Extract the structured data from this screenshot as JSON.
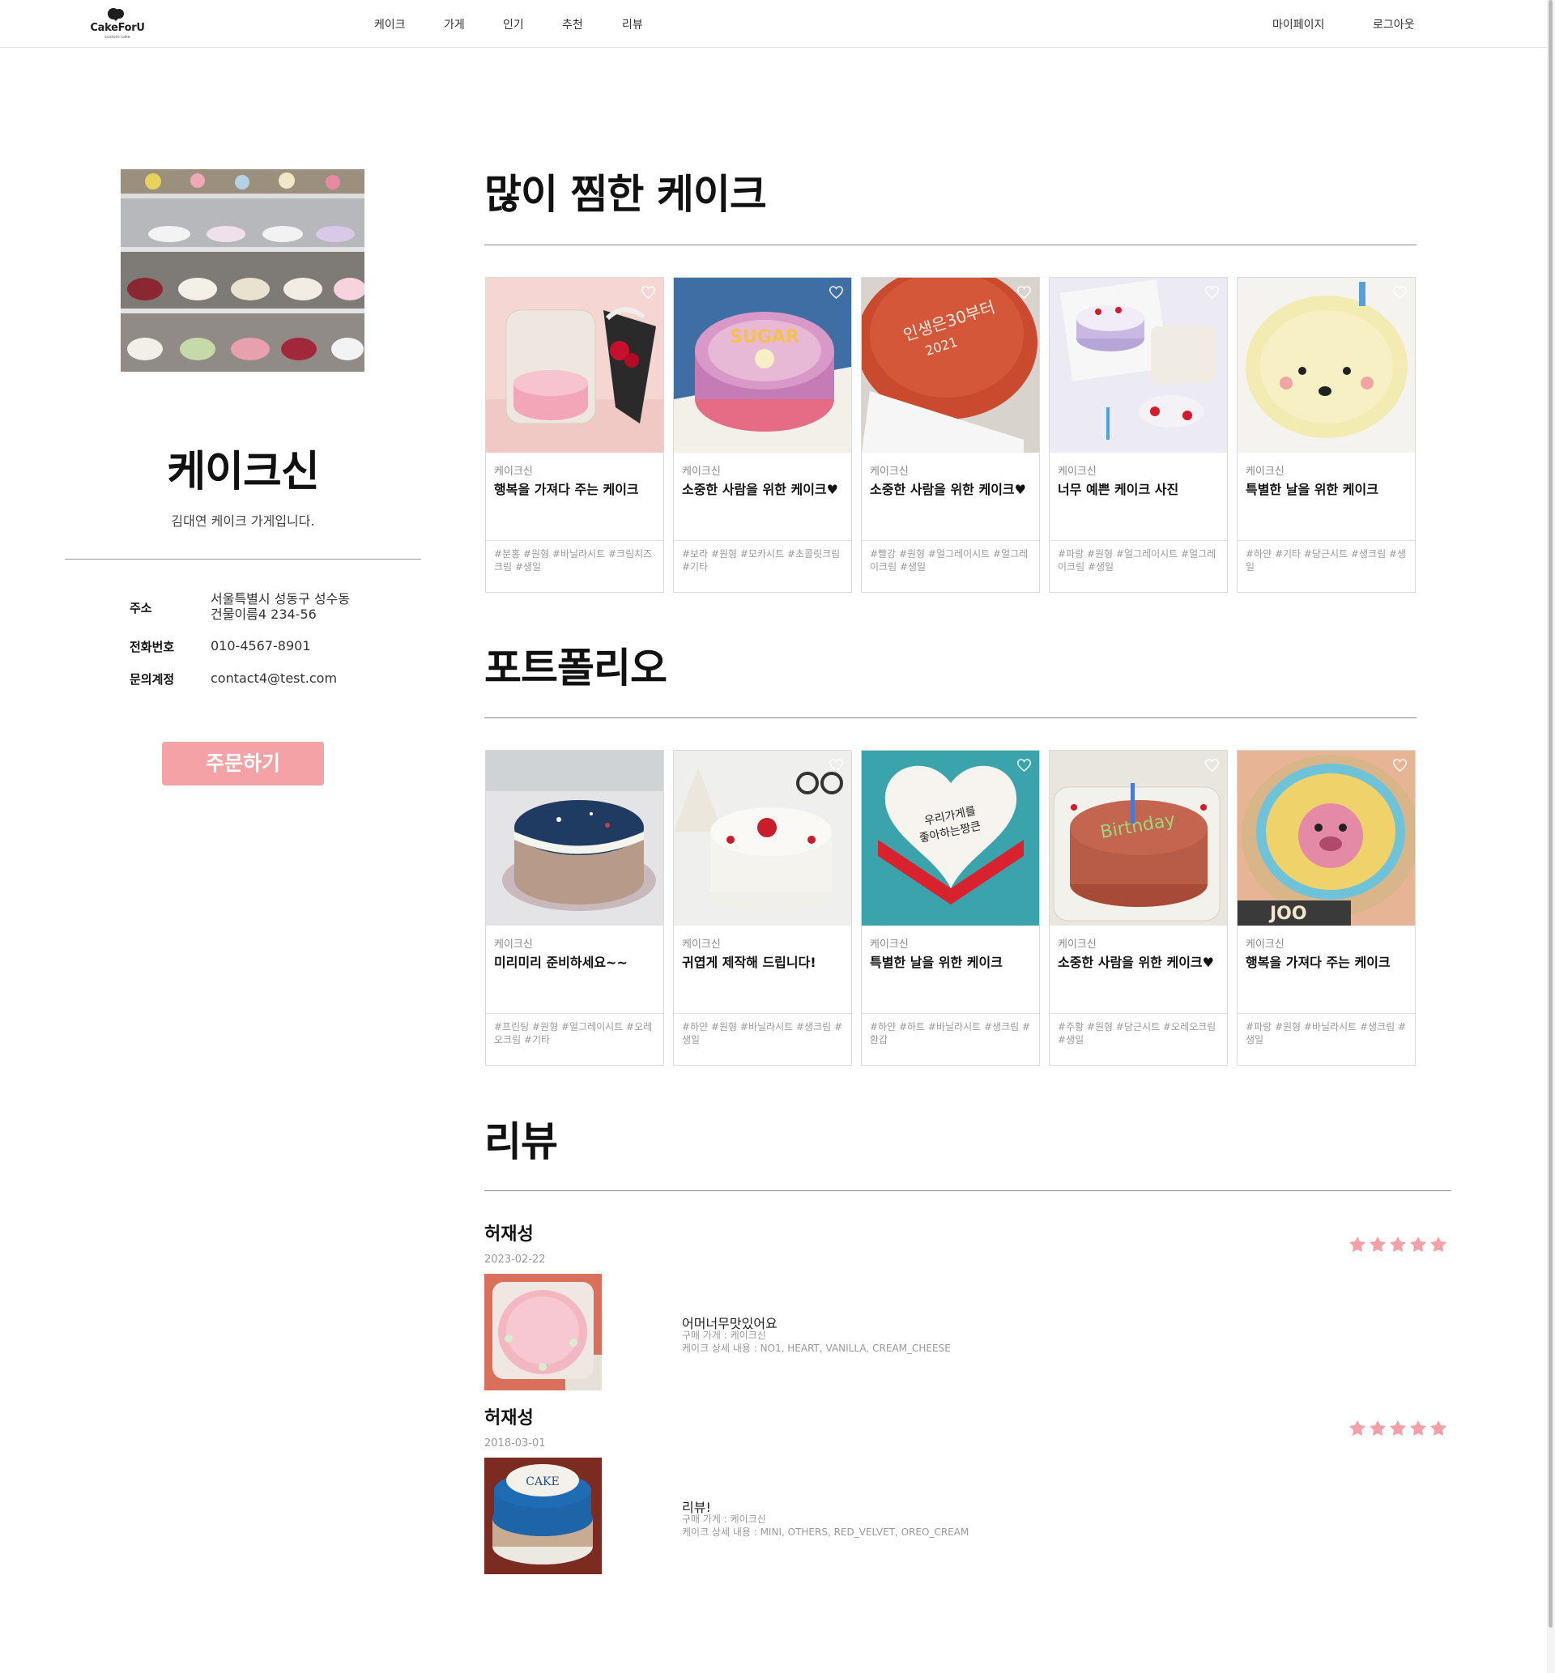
{
  "header": {
    "logo_text": "CakeForU",
    "logo_sub": "custom cake",
    "nav": [
      "케이크",
      "가게",
      "인기",
      "추천",
      "리뷰"
    ],
    "right": [
      "마이페이지",
      "로그아웃"
    ]
  },
  "shop": {
    "name": "케이크신",
    "description": "김대연 케이크 가게입니다.",
    "info": [
      {
        "label": "주소",
        "value": "서울특별시 성동구 성수동",
        "value2": "건물이름4 234-56"
      },
      {
        "label": "전화번호",
        "value": "010-4567-8901"
      },
      {
        "label": "문의계정",
        "value": "contact4@test.com"
      }
    ],
    "order_button": "주문하기"
  },
  "sections": {
    "popular_title": "많이 찜한 케이크",
    "portfolio_title": "포트폴리오",
    "review_title": "리뷰"
  },
  "popular_cards": [
    {
      "shop": "케이크신",
      "title": "행복을 가져다 주는 케이크",
      "tags": "#분홍 #원형 #바닐라시트 #크림치즈크림 #생일"
    },
    {
      "shop": "케이크신",
      "title": "소중한 사람을 위한 케이크♥",
      "tags": "#보라 #원형 #모카시트 #초콜릿크림 #기타"
    },
    {
      "shop": "케이크신",
      "title": "소중한 사람을 위한 케이크♥",
      "tags": "#빨강 #원형 #얼그레이시트 #얼그레이크림 #생일"
    },
    {
      "shop": "케이크신",
      "title": "너무 예쁜 케이크 사진",
      "tags": "#파랑 #원형 #얼그레이시트 #얼그레이크림 #생일"
    },
    {
      "shop": "케이크신",
      "title": "특별한 날을 위한 케이크",
      "tags": "#하얀 #기타 #당근시트 #생크림 #생일"
    }
  ],
  "portfolio_cards": [
    {
      "shop": "케이크신",
      "title": "미리미리 준비하세요~~",
      "tags": "#프린팅 #원형 #얼그레이시트 #오레오크림 #기타"
    },
    {
      "shop": "케이크신",
      "title": "귀엽게 제작해 드립니다!",
      "tags": "#하얀 #원형 #바닐라시트 #생크림 #생일"
    },
    {
      "shop": "케이크신",
      "title": "특별한 날을 위한 케이크",
      "tags": "#하얀 #하트 #바닐라시트 #생크림 #환갑"
    },
    {
      "shop": "케이크신",
      "title": "소중한 사람을 위한 케이크♥",
      "tags": "#주황 #원형 #당근시트 #오레오크림 #생일"
    },
    {
      "shop": "케이크신",
      "title": "행복을 가져다 주는 케이크",
      "tags": "#파랑 #원형 #바닐라시트 #생크림 #생일"
    }
  ],
  "reviews": [
    {
      "name": "허재성",
      "date": "2023-02-22",
      "content": "어머너무맛있어요",
      "store": "구매 가게 : 케이크신",
      "detail": "케이크 상세 내용 : NO1, HEART, VANILLA, CREAM_CHEESE",
      "rating": 5
    },
    {
      "name": "허재성",
      "date": "2018-03-01",
      "content": "리뷰!",
      "store": "구매 가게 : 케이크신",
      "detail": "케이크 상세 내용 : MINI, OTHERS, RED_VELVET, OREO_CREAM",
      "rating": 5
    }
  ],
  "colors": {
    "accent": "#f5a2a6",
    "star": "#f4a0a6",
    "text": "#111111"
  }
}
